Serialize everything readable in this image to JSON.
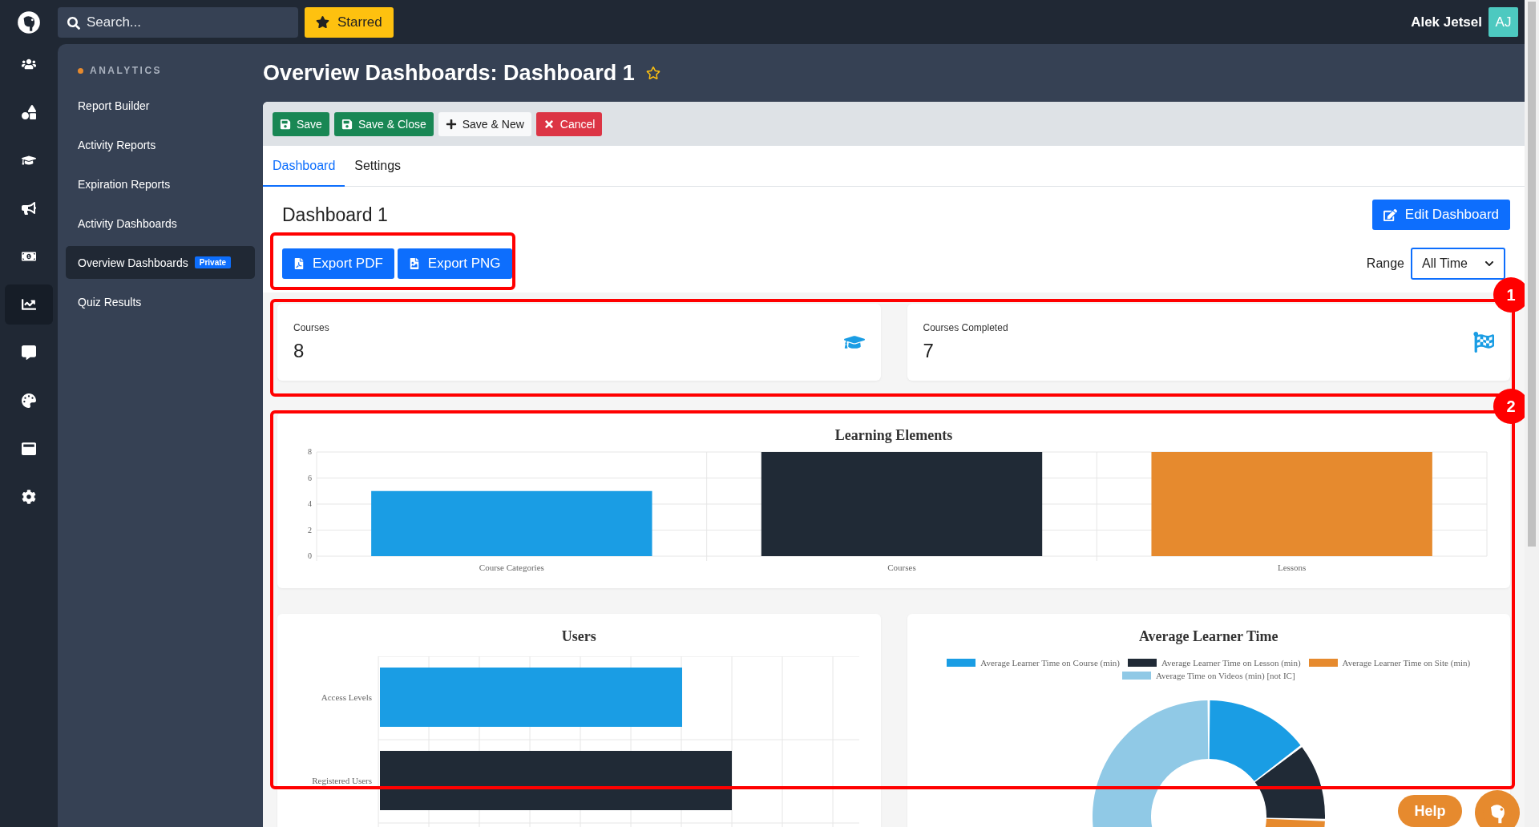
{
  "topbar": {
    "search": {
      "placeholder": "Search..."
    },
    "starred": "Starred",
    "user": {
      "name": "Alek Jetsel",
      "initials": "AJ"
    }
  },
  "rail": [
    {
      "kind": "users",
      "selected": false
    },
    {
      "kind": "shapes",
      "selected": false
    },
    {
      "kind": "courses",
      "selected": false
    },
    {
      "kind": "announce",
      "selected": false
    },
    {
      "kind": "money",
      "selected": false
    },
    {
      "kind": "analytics",
      "selected": true
    },
    {
      "kind": "chat",
      "selected": false
    },
    {
      "kind": "palette",
      "selected": false
    },
    {
      "kind": "window",
      "selected": false
    },
    {
      "kind": "settings",
      "selected": false
    }
  ],
  "sidebar": {
    "heading": "ANALYTICS",
    "items": [
      {
        "label": "Report Builder",
        "selected": false
      },
      {
        "label": "Activity Reports",
        "selected": false
      },
      {
        "label": "Expiration Reports",
        "selected": false
      },
      {
        "label": "Activity Dashboards",
        "selected": false
      },
      {
        "label": "Overview Dashboards",
        "selected": true,
        "badge": "Private"
      },
      {
        "label": "Quiz Results",
        "selected": false
      }
    ]
  },
  "page": {
    "title": "Overview Dashboards: Dashboard 1",
    "starred": false
  },
  "toolbar": [
    {
      "kind": "save",
      "label": "Save"
    },
    {
      "kind": "save",
      "label": "Save & Close"
    },
    {
      "kind": "new",
      "label": "Save & New"
    },
    {
      "kind": "cancel",
      "label": "Cancel"
    }
  ],
  "tabs": [
    {
      "label": "Dashboard",
      "selected": true
    },
    {
      "label": "Settings",
      "selected": false
    }
  ],
  "dashboard": {
    "title": "Dashboard 1",
    "edit_button": "Edit Dashboard",
    "exports": [
      {
        "kind": "pdf",
        "label": "Export PDF"
      },
      {
        "kind": "png",
        "label": "Export PNG"
      }
    ],
    "range": {
      "label": "Range",
      "value": "All Time"
    },
    "stats": [
      {
        "kind": "courses",
        "label": "Courses",
        "value": "8"
      },
      {
        "kind": "completed",
        "label": "Courses Completed",
        "value": "7"
      }
    ],
    "learning": {
      "chart_data": {
        "type": "bar",
        "title": "Learning Elements",
        "categories": [
          "Course Categories",
          "Courses",
          "Lessons"
        ],
        "series": [
          {
            "color": "#1a9de4",
            "values": [
              5,
              null,
              null
            ]
          },
          {
            "color": "#202a36",
            "values": [
              null,
              8,
              null
            ]
          },
          {
            "color": "#e68a2e",
            "values": [
              null,
              null,
              8
            ]
          }
        ],
        "ylim": [
          0,
          8
        ],
        "yticks": [
          0,
          2,
          4,
          6,
          8
        ],
        "grid": true
      }
    },
    "users": {
      "title": "Users",
      "categories": [
        "Access Levels",
        "Registered Users"
      ]
    },
    "avg_time": {
      "title": "Average Learner Time",
      "legend": [
        {
          "label": "Average Learner Time on Course (min)",
          "color": "#1a9de4"
        },
        {
          "label": "Average Learner Time on Lesson (min)",
          "color": "#202a36"
        },
        {
          "label": "Average Learner Time on Site (min)",
          "color": "#e68a2e"
        },
        {
          "label": "Average Time on Videos (min) [not IC]",
          "color": "#90c9e6"
        }
      ]
    }
  },
  "annotations": [
    "1",
    "2"
  ],
  "help": "Help"
}
